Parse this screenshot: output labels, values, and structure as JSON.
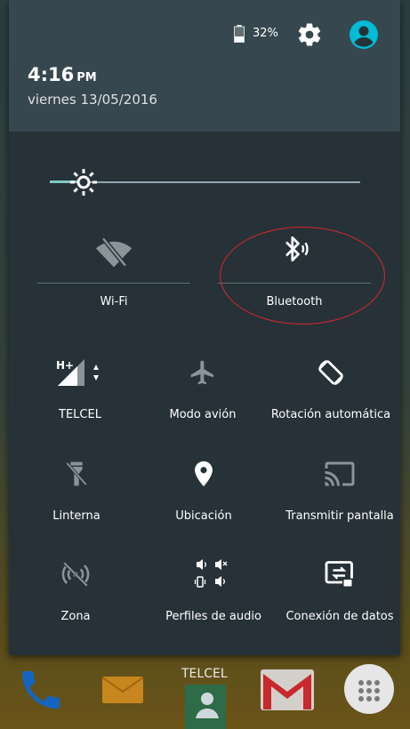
{
  "status": {
    "battery_percent": "32%",
    "time": "4:16",
    "time_suffix": "PM",
    "date": "viernes 13/05/2016"
  },
  "brightness": {
    "level_fraction": 0.11
  },
  "big_tiles": [
    {
      "label": "Wi-Fi",
      "icon": "wifi-off-icon",
      "state": "off"
    },
    {
      "label": "Bluetooth",
      "icon": "bluetooth-icon",
      "state": "on"
    }
  ],
  "tiles": [
    {
      "label": "TELCEL",
      "icon": "cell-signal-icon",
      "network": "H+"
    },
    {
      "label": "Modo avión",
      "icon": "airplane-icon"
    },
    {
      "label": "Rotación automática",
      "icon": "auto-rotate-icon"
    },
    {
      "label": "Linterna",
      "icon": "flashlight-off-icon"
    },
    {
      "label": "Ubicación",
      "icon": "location-icon"
    },
    {
      "label": "Transmitir pantalla",
      "icon": "cast-icon"
    },
    {
      "label": "Zona",
      "icon": "hotspot-icon"
    },
    {
      "label": "Perfiles de audio",
      "icon": "audio-profiles-icon"
    },
    {
      "label": "Conexión de datos",
      "icon": "data-connection-icon"
    }
  ],
  "dock": {
    "carrier": "TELCEL"
  },
  "colors": {
    "shade": "#263238",
    "header": "#37474f",
    "accent": "#80cbc4",
    "annotation": "#d8262b",
    "avatar": "#00bcd4"
  }
}
